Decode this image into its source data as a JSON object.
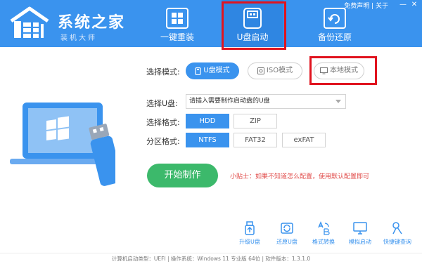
{
  "header": {
    "logo_title": "系统之家",
    "logo_subtitle": "装机大师",
    "tabs": [
      {
        "label": "一键重装",
        "icon": "windows-icon"
      },
      {
        "label": "U盘启动",
        "icon": "usb-drive-icon",
        "active": true
      },
      {
        "label": "备份还原",
        "icon": "backup-restore-icon"
      }
    ],
    "top_links": "免费声明 | 关于",
    "minimize_label": "—",
    "close_label": "✕"
  },
  "form": {
    "mode_label": "选择模式:",
    "modes": [
      {
        "label": "U盘模式",
        "icon": "usb-icon",
        "selected": true
      },
      {
        "label": "ISO模式",
        "icon": "disc-icon",
        "selected": false
      },
      {
        "label": "本地模式",
        "icon": "monitor-icon",
        "selected": false
      }
    ],
    "usb_label": "选择U盘:",
    "usb_placeholder": "请插入需要制作启动盘的U盘",
    "format_label": "选择格式:",
    "formats": [
      {
        "label": "HDD",
        "selected": true
      },
      {
        "label": "ZIP",
        "selected": false
      }
    ],
    "partition_label": "分区格式:",
    "partitions": [
      {
        "label": "NTFS",
        "selected": true
      },
      {
        "label": "FAT32",
        "selected": false
      },
      {
        "label": "exFAT",
        "selected": false
      }
    ],
    "start_button": "开始制作",
    "tip": "小贴士：如果不知道怎么配置，使用默认配置即可"
  },
  "tools": [
    {
      "label": "升级U盘",
      "icon": "usb-upgrade-icon"
    },
    {
      "label": "还原U盘",
      "icon": "usb-restore-icon"
    },
    {
      "label": "格式转换",
      "icon": "format-convert-icon"
    },
    {
      "label": "模拟启动",
      "icon": "monitor-icon"
    },
    {
      "label": "快捷键查询",
      "icon": "key-search-icon"
    }
  ],
  "footer": "计算机启动类型：UEFI | 操作系统：Windows 11 专业版 64位 | 软件版本：1.3.1.0",
  "colors": {
    "brand_blue": "#3a93ee",
    "start_green": "#3cb96b",
    "tip_red": "#e04a48",
    "highlight_red": "#e0131e"
  }
}
